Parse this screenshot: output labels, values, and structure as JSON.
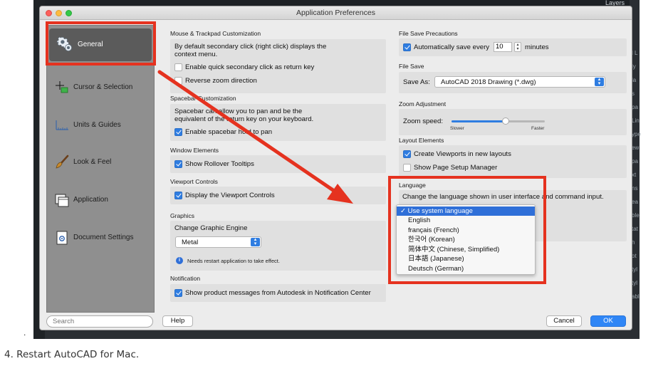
{
  "window": {
    "title": "Application Preferences"
  },
  "background": {
    "layers_label": "Layers",
    "right_snippets": [
      "l L",
      "ly",
      "la",
      "s",
      "pa",
      "Lin",
      "ype",
      "ew",
      "pa",
      "xt",
      "ns",
      "ea",
      "ble",
      "tat",
      "h",
      "ot",
      "tyl",
      "tyl",
      "abl"
    ]
  },
  "sidebar": {
    "items": [
      {
        "label": "General",
        "icon": "gear-icon"
      },
      {
        "label": "Cursor & Selection",
        "icon": "cursor-icon"
      },
      {
        "label": "Units & Guides",
        "icon": "ruler-icon"
      },
      {
        "label": "Look & Feel",
        "icon": "brush-icon"
      },
      {
        "label": "Application",
        "icon": "window-icon"
      },
      {
        "label": "Document Settings",
        "icon": "document-icon"
      }
    ],
    "search_placeholder": "Search"
  },
  "left": {
    "mouse": {
      "header": "Mouse & Trackpad Customization",
      "text1": "By default secondary click (right click) displays the",
      "text2": "context menu.",
      "opt1": {
        "label": "Enable quick secondary click as return key",
        "checked": false
      },
      "opt2": {
        "label": "Reverse zoom direction",
        "checked": false
      }
    },
    "spacebar": {
      "header": "Spacebar Customization",
      "text1": "Spacebar can allow you to pan and be the",
      "text2": "equivalent of the return key on your keyboard.",
      "opt1": {
        "label": "Enable spacebar hold to pan",
        "checked": true
      }
    },
    "window_elements": {
      "header": "Window Elements",
      "opt1": {
        "label": "Show Rollover Tooltips",
        "checked": true
      }
    },
    "viewport_controls": {
      "header": "Viewport Controls",
      "opt1": {
        "label": "Display the Viewport Controls",
        "checked": true
      }
    },
    "graphics": {
      "header": "Graphics",
      "subhead": "Change Graphic Engine",
      "engine": "Metal",
      "note": "Needs restart application to take effect."
    },
    "notification": {
      "header": "Notification",
      "opt1": {
        "label": "Show product messages from Autodesk in Notification Center",
        "checked": true
      }
    }
  },
  "right": {
    "file_save_precautions": {
      "header": "File Save Precautions",
      "label_pre": "Automatically save every",
      "value": "10",
      "label_post": "minutes",
      "checked": true
    },
    "file_save": {
      "header": "File Save",
      "save_as_label": "Save As:",
      "save_as_value": "AutoCAD 2018 Drawing (*.dwg)"
    },
    "zoom": {
      "header": "Zoom Adjustment",
      "label": "Zoom speed:",
      "slower": "Slower",
      "faster": "Faster",
      "value_fraction": 0.58
    },
    "layout": {
      "header": "Layout Elements",
      "opt1": {
        "label": "Create Viewports in new layouts",
        "checked": true
      },
      "opt2": {
        "label": "Show Page Setup Manager",
        "checked": false
      }
    },
    "language": {
      "header": "Language",
      "description": "Change the language shown in user interface and command input.",
      "options": [
        "Use system language",
        "English",
        "français (French)",
        "한국어 (Korean)",
        "简体中文 (Chinese, Simplified)",
        "日本語 (Japanese)",
        "Deutsch (German)"
      ],
      "selected_index": 0
    }
  },
  "footer": {
    "help": "Help",
    "cancel": "Cancel",
    "ok": "OK"
  },
  "annotation": {
    "color": "#e5321f"
  },
  "caption": "4. Restart AutoCAD for Mac.",
  "bullet": "."
}
